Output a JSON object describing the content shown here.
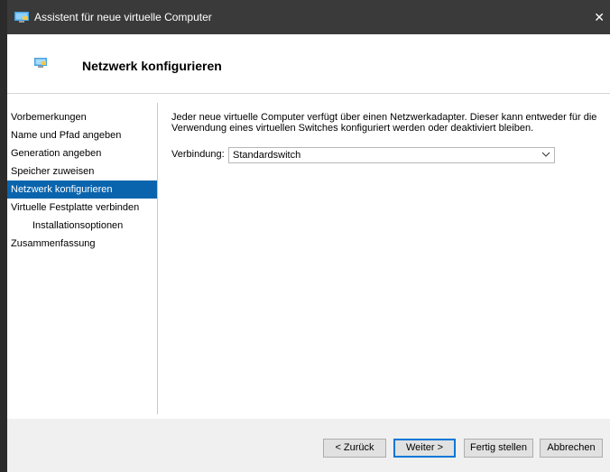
{
  "window": {
    "title": "Assistent für neue virtuelle Computer",
    "close_label": "✕"
  },
  "header": {
    "title": "Netzwerk konfigurieren"
  },
  "nav": {
    "items": [
      {
        "label": "Vorbemerkungen"
      },
      {
        "label": "Name und Pfad angeben"
      },
      {
        "label": "Generation angeben"
      },
      {
        "label": "Speicher zuweisen"
      },
      {
        "label": "Netzwerk konfigurieren",
        "active": true
      },
      {
        "label": "Virtuelle Festplatte verbinden"
      },
      {
        "label": "Installationsoptionen"
      },
      {
        "label": "Zusammenfassung"
      }
    ]
  },
  "content": {
    "description_line1": "Jeder neue virtuelle Computer verfügt über einen Netzwerkadapter. Dieser kann entweder für die",
    "description_line2": "Verwendung eines virtuellen Switches konfiguriert werden oder deaktiviert bleiben.",
    "connection_label": "Verbindung:",
    "connection_value": "Standardswitch"
  },
  "footer": {
    "back_label": "< Zurück",
    "next_label": "Weiter >",
    "finish_label": "Fertig stellen",
    "cancel_label": "Abbrechen"
  },
  "colors": {
    "accent": "#0a64ad",
    "titlebar": "#3a3a3a"
  },
  "icons": {
    "app": "hyperv-monitor-icon",
    "header": "network-monitor-icon",
    "dropdown": "chevron-down-icon",
    "close": "close-icon"
  }
}
